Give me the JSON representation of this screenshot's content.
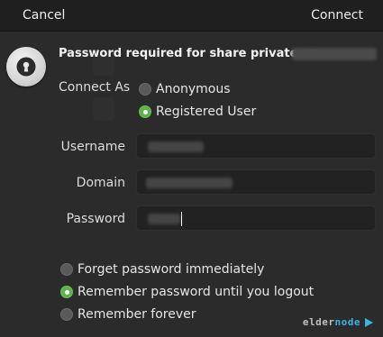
{
  "headerbar": {
    "cancel_label": "Cancel",
    "connect_label": "Connect"
  },
  "icon": "lock-icon",
  "title": "Password required for share private on",
  "connect_as": {
    "label": "Connect As",
    "options": [
      {
        "label": "Anonymous",
        "selected": false
      },
      {
        "label": "Registered User",
        "selected": true
      }
    ]
  },
  "fields": {
    "username_label": "Username",
    "domain_label": "Domain",
    "password_label": "Password"
  },
  "remember": {
    "options": [
      {
        "label": "Forget password immediately",
        "selected": false
      },
      {
        "label": "Remember password until you logout",
        "selected": true
      },
      {
        "label": "Remember forever",
        "selected": false
      }
    ]
  },
  "watermark": {
    "part1": "elder",
    "part2": "node"
  },
  "colors": {
    "accent": "#5fb14a",
    "background": "#2b2b2b",
    "headerbar": "#1f1f1f"
  }
}
